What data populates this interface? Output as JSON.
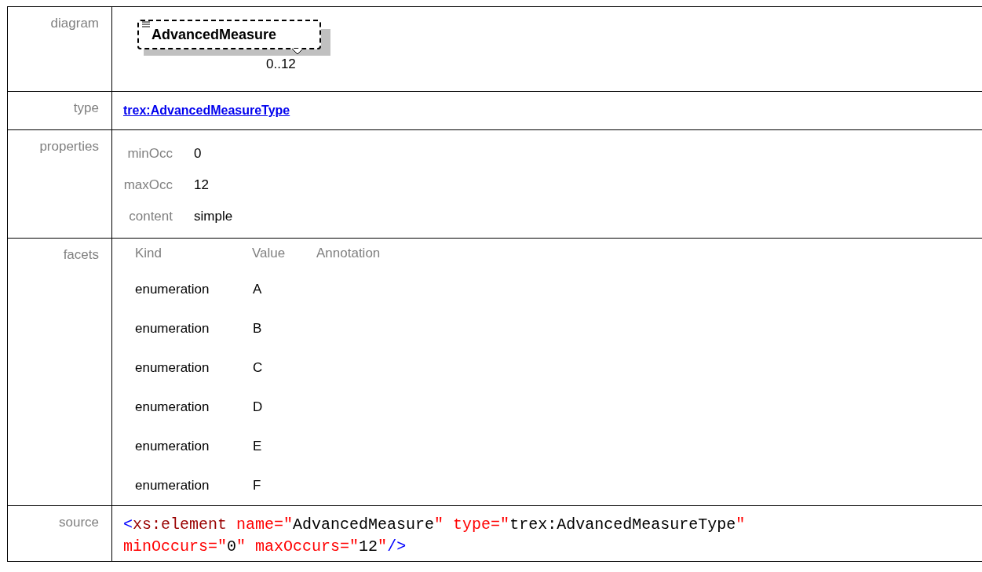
{
  "rows": [
    {
      "kind": "diagram",
      "label": "diagram",
      "element": {
        "name": "AdvancedMeasure",
        "occurrence": "0..12"
      }
    },
    {
      "kind": "type",
      "label": "type",
      "link": "trex:AdvancedMeasureType"
    },
    {
      "kind": "properties",
      "label": "properties",
      "items": [
        {
          "name": "minOcc",
          "value": "0"
        },
        {
          "name": "maxOcc",
          "value": "12"
        },
        {
          "name": "content",
          "value": "simple"
        }
      ]
    },
    {
      "kind": "facets",
      "label": "facets",
      "columns": [
        "Kind",
        "Value",
        "Annotation"
      ],
      "items": [
        {
          "kind": "enumeration",
          "value": "A"
        },
        {
          "kind": "enumeration",
          "value": "B"
        },
        {
          "kind": "enumeration",
          "value": "C"
        },
        {
          "kind": "enumeration",
          "value": "D"
        },
        {
          "kind": "enumeration",
          "value": "E"
        },
        {
          "kind": "enumeration",
          "value": "F"
        }
      ]
    },
    {
      "kind": "source",
      "label": "source",
      "lines": [
        [
          {
            "kind": "punct",
            "text": "<"
          },
          {
            "kind": "tag",
            "text": "xs:element"
          },
          {
            "kind": "attr",
            "text": " name=\""
          },
          {
            "kind": "value",
            "text": "AdvancedMeasure"
          },
          {
            "kind": "attr",
            "text": "\""
          },
          {
            "kind": "attr",
            "text": " type=\""
          },
          {
            "kind": "value",
            "text": "trex:AdvancedMeasureType"
          },
          {
            "kind": "attr",
            "text": "\""
          }
        ],
        [
          {
            "kind": "attr",
            "text": "minOccurs=\""
          },
          {
            "kind": "value",
            "text": "0"
          },
          {
            "kind": "attr",
            "text": "\""
          },
          {
            "kind": "attr",
            "text": " maxOccurs=\""
          },
          {
            "kind": "value",
            "text": "12"
          },
          {
            "kind": "attr",
            "text": "\""
          },
          {
            "kind": "punct",
            "text": "/>"
          }
        ]
      ]
    }
  ]
}
